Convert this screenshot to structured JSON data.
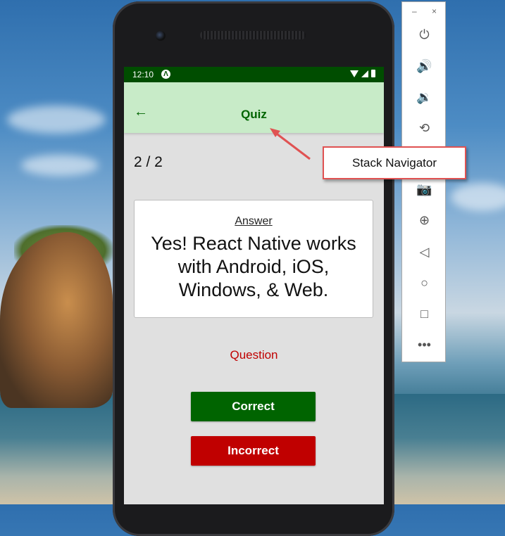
{
  "status_bar": {
    "time": "12:10",
    "app_icon": "expo-icon",
    "icons": [
      "wifi-icon",
      "signal-icon",
      "battery-icon"
    ]
  },
  "app_bar": {
    "back_icon": "arrow-left-icon",
    "title": "Quiz"
  },
  "quiz": {
    "counter": "2 / 2",
    "card_label": "Answer",
    "card_text": "Yes! React Native works with Android, iOS, Windows, & Web.",
    "toggle_label": "Question",
    "correct_label": "Correct",
    "incorrect_label": "Incorrect"
  },
  "emulator_toolbar": {
    "window_controls": [
      "–",
      "×"
    ],
    "items": [
      "power-icon",
      "volume-up-icon",
      "volume-down-icon",
      "rotate-icon",
      "camera-icon",
      "zoom-icon",
      "back-icon",
      "home-icon",
      "overview-icon",
      "more-icon"
    ]
  },
  "callout": {
    "text": "Stack Navigator"
  },
  "colors": {
    "status_bar": "#004d00",
    "app_bar": "#c8ebc8",
    "accent_green": "#006400",
    "accent_red": "#c00000",
    "screen_bg": "#e0e0e0",
    "callout_border": "#e05252"
  }
}
